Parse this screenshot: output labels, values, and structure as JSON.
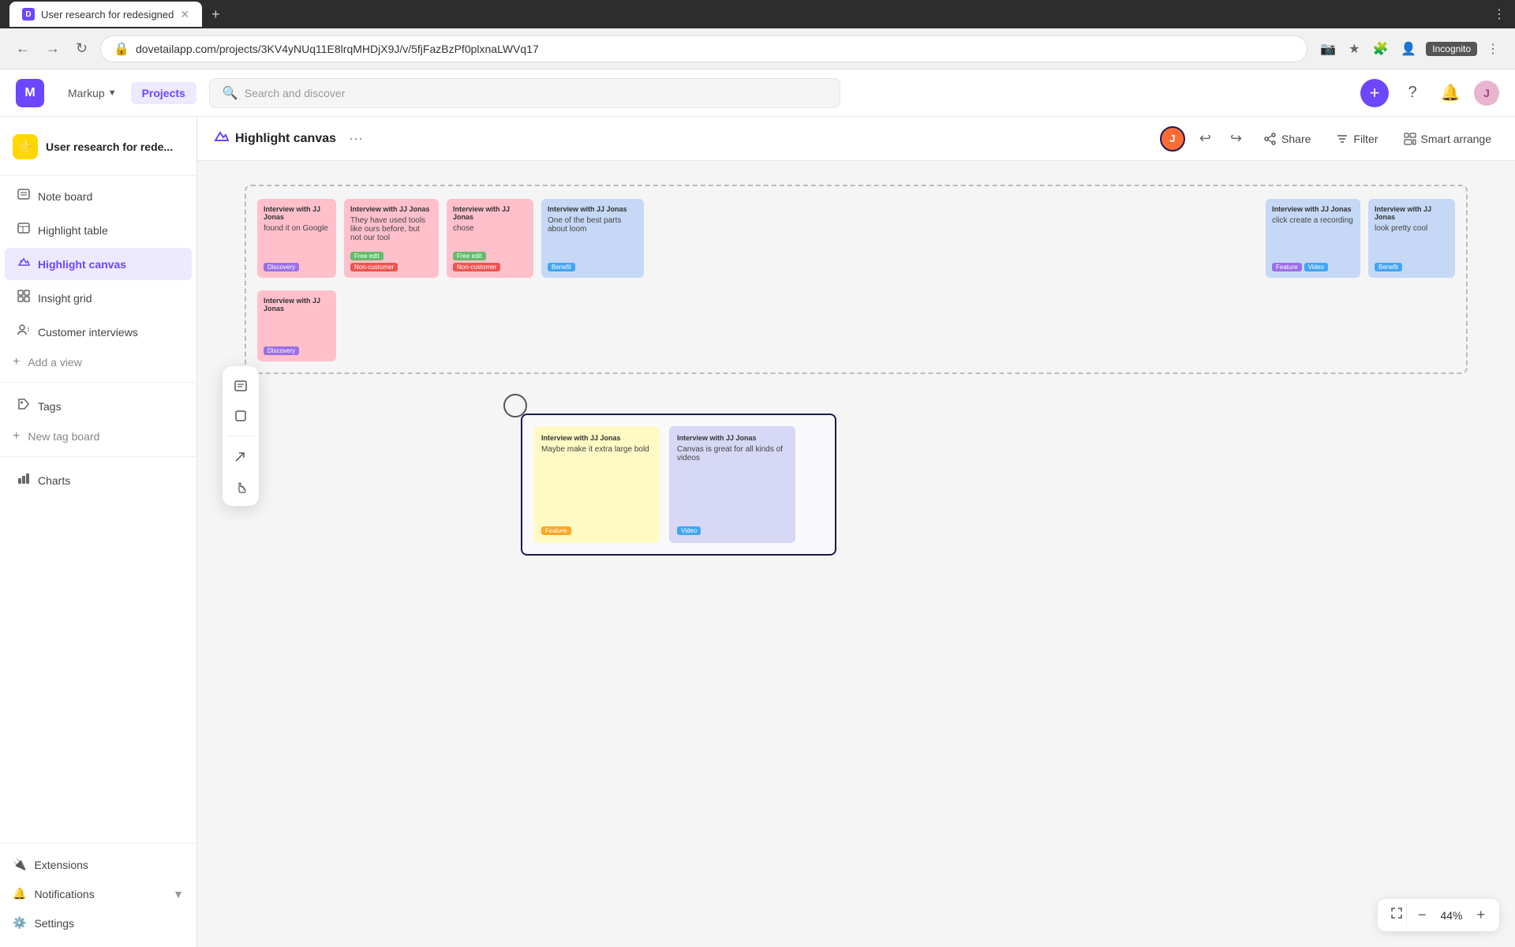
{
  "browser": {
    "tab_title": "User research for redesigned",
    "tab_favicon": "D",
    "address": "dovetailapp.com/projects/3KV4yNUq11E8lrqMHDjX9J/v/5fjFazBzPf0plxnaLWVq17",
    "incognito": "Incognito"
  },
  "header": {
    "logo": "M",
    "markup_label": "Markup",
    "nav_items": [
      "Markup",
      "Projects"
    ],
    "search_placeholder": "Search and discover",
    "avatar_text": "J"
  },
  "sidebar": {
    "project_name": "User research for rede...",
    "project_emoji": "⭐",
    "items": [
      {
        "id": "note-board",
        "label": "Note board",
        "icon": "📋"
      },
      {
        "id": "highlight-table",
        "label": "Highlight table",
        "icon": "📊"
      },
      {
        "id": "highlight-canvas",
        "label": "Highlight canvas",
        "icon": "✏️",
        "active": true
      },
      {
        "id": "insight-grid",
        "label": "Insight grid",
        "icon": "🔲"
      },
      {
        "id": "customer-interviews",
        "label": "Customer interviews",
        "icon": "🎤"
      },
      {
        "id": "add-view",
        "label": "Add a view",
        "icon": "+"
      }
    ],
    "tags_label": "Tags",
    "new_tag_board": "New tag board",
    "charts_label": "Charts",
    "bottom_items": [
      {
        "id": "extensions",
        "label": "Extensions",
        "icon": "🔌"
      },
      {
        "id": "notifications",
        "label": "Notifications",
        "icon": "🔔"
      },
      {
        "id": "settings",
        "label": "Settings",
        "icon": "⚙️"
      }
    ]
  },
  "canvas": {
    "title": "Highlight canvas",
    "title_icon": "✏️",
    "more_label": "···",
    "share_label": "Share",
    "filter_label": "Filter",
    "smart_arrange_label": "Smart arrange",
    "user_initial": "J",
    "zoom_level": "44%"
  },
  "cards": {
    "top_row": [
      {
        "id": "card1",
        "interviewer": "Interview with JJ Jonas",
        "text": "found it on Google",
        "tags": [
          {
            "label": "Discovery",
            "color": "purple"
          }
        ],
        "color": "pink"
      },
      {
        "id": "card2",
        "interviewer": "Interview with JJ Jonas",
        "text": "They have used tools like ours before, but not our tool",
        "tags": [
          {
            "label": "Free edit",
            "color": "green"
          },
          {
            "label": "Non-customer",
            "color": "red"
          }
        ],
        "color": "pink"
      },
      {
        "id": "card3",
        "interviewer": "Interview with JJ Jonas",
        "text": "chose",
        "tags": [
          {
            "label": "Free edit",
            "color": "green"
          },
          {
            "label": "Non-customer",
            "color": "red"
          }
        ],
        "color": "pink"
      },
      {
        "id": "card4",
        "interviewer": "Interview with JJ Jonas",
        "text": "One of the best parts about loom",
        "tags": [
          {
            "label": "Benefit",
            "color": "blue"
          }
        ],
        "color": "blue"
      },
      {
        "id": "card5",
        "interviewer": "Interview with JJ Jonas",
        "text": "click create a recording",
        "tags": [
          {
            "label": "Feature",
            "color": "purple"
          },
          {
            "label": "Video",
            "color": "blue"
          }
        ],
        "color": "blue"
      },
      {
        "id": "card6",
        "interviewer": "Interview with JJ Jonas",
        "text": "look pretty cool",
        "tags": [
          {
            "label": "Benefit",
            "color": "blue"
          }
        ],
        "color": "blue"
      }
    ],
    "top_row2": [
      {
        "id": "card7",
        "interviewer": "Interview with JJ Jonas",
        "text": "",
        "tags": [
          {
            "label": "Discovery",
            "color": "purple"
          }
        ],
        "color": "pink"
      }
    ],
    "bottom_group": [
      {
        "id": "card8",
        "interviewer": "Interview with JJ Jonas",
        "text": "Maybe make it extra large bold",
        "tags": [
          {
            "label": "Feature",
            "color": "orange"
          }
        ],
        "color": "yellow"
      },
      {
        "id": "card9",
        "interviewer": "Interview with JJ Jonas",
        "text": "Canvas is great for all kinds of videos",
        "tags": [
          {
            "label": "Video",
            "color": "blue"
          }
        ],
        "color": "blue"
      }
    ]
  },
  "tools": {
    "items": [
      "text",
      "rect",
      "arrow",
      "hand"
    ]
  }
}
